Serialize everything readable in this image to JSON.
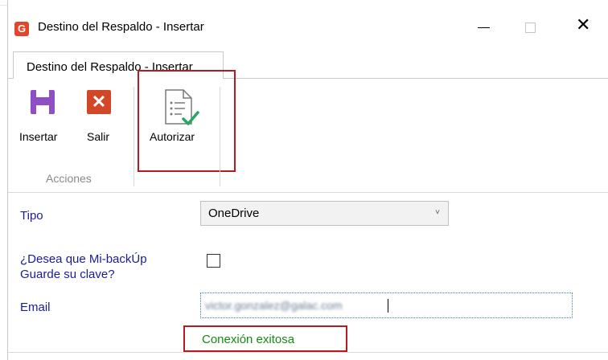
{
  "window": {
    "title": "Destino del Respaldo - Insertar",
    "app_icon_glyph": "G",
    "close_glyph": "✕"
  },
  "tab": {
    "label": "Destino del Respaldo - Insertar"
  },
  "ribbon": {
    "buttons": [
      {
        "label": "Insertar",
        "icon": "save-icon"
      },
      {
        "label": "Salir",
        "icon": "close-icon",
        "glyph": "✕"
      },
      {
        "label": "Autorizar",
        "icon": "checklist-icon"
      }
    ],
    "group_label": "Acciones"
  },
  "form": {
    "tipo": {
      "label": "Tipo",
      "value": "OneDrive",
      "arrow": "˅"
    },
    "guardar_clave": {
      "label_line1": "¿Desea que Mi-backÚp",
      "label_line2": "Guarde su clave?",
      "checked": false
    },
    "email": {
      "label": "Email",
      "value": "victor.gonzalez@galac.com"
    },
    "status": "Conexión exitosa"
  },
  "colors": {
    "accent_border": "#b31b23",
    "label_blue": "#1a1a9c",
    "status_green": "#138a13",
    "save_purple": "#8e4ec6",
    "exit_red": "#d24726"
  }
}
